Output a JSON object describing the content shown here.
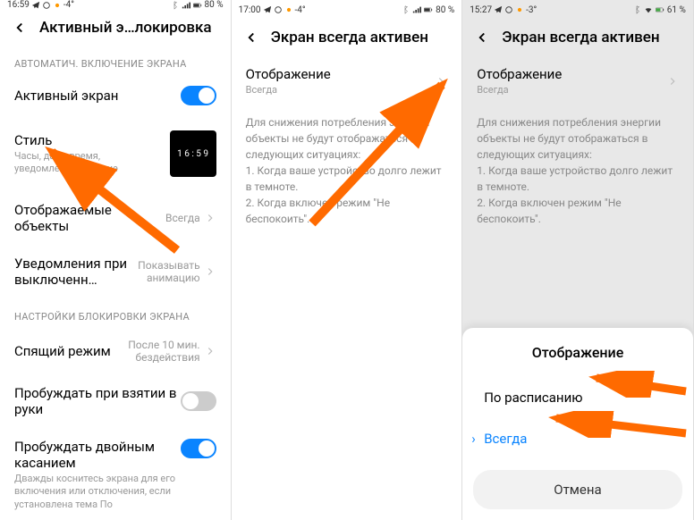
{
  "status": {
    "time1": "16:59",
    "time2": "17:00",
    "time3": "15:27",
    "temp12": "-4°",
    "temp3": "-3°",
    "bat12": "80 %",
    "bat3": "61 %"
  },
  "screen1": {
    "title": "Активный э…локировка",
    "section1": "АВТОМАТИЧ. ВКЛЮЧЕНИЕ ЭКРАНА",
    "activeScreen": "Активный экран",
    "style": "Стиль",
    "styleSub": "Часы, дата, время, уведомления и другие",
    "styleClock": "1 6 : 5 9",
    "displayed": "Отображаемые объекты",
    "displayedVal": "Всегда",
    "notif": "Уведомления при выключенн…",
    "notifVal": "Показывать анимацию",
    "section2": "НАСТРОЙКИ БЛОКИРОВКИ ЭКРАНА",
    "sleep": "Спящий режим",
    "sleepVal": "После 10 мин. бездействия",
    "wakeHand": "Пробуждать при взятии в руки",
    "wakeTap": "Пробуждать двойным касанием",
    "wakeTapSub": "Дважды коснитесь экрана для его включения или отключения, если установлена тема По"
  },
  "screen2": {
    "title": "Экран всегда активен",
    "display": "Отображение",
    "displayVal": "Всегда",
    "desc": "Для снижения потребления энергии объекты не будут отображаться в следующих ситуациях:\n1. Когда ваше устройство долго лежит в темноте.\n2. Когда включен режим \"Не беспокоить\"."
  },
  "screen3": {
    "title": "Экран всегда активен",
    "display": "Отображение",
    "displayVal": "Всегда",
    "desc": "Для снижения потребления энергии объекты не будут отображаться в следующих ситуациях:\n1. Когда ваше устройство долго лежит в темноте.\n2. Когда включен режим \"Не беспокоить\".",
    "sheetTitle": "Отображение",
    "opt1": "По расписанию",
    "opt2": "Всегда",
    "cancel": "Отмена"
  }
}
